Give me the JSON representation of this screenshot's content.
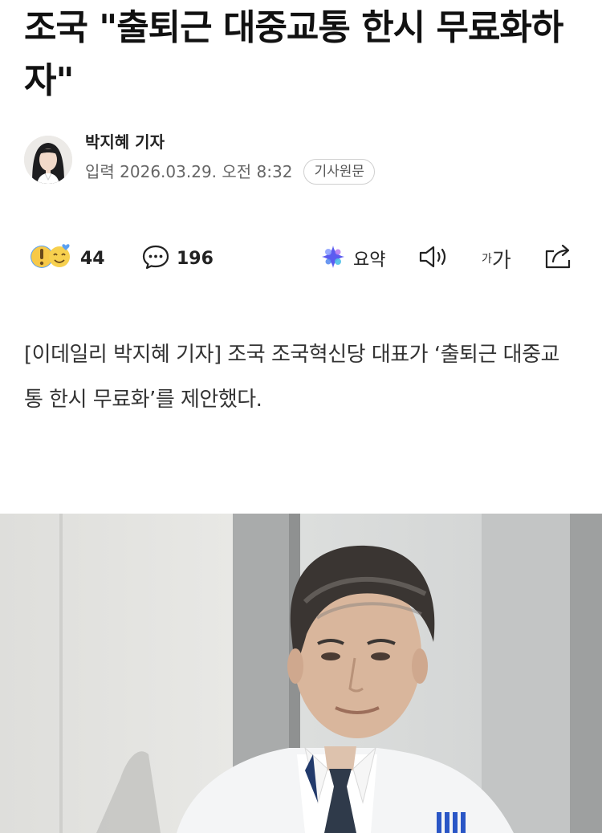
{
  "article": {
    "headline": "조국 \"출퇴근 대중교통 한시 무료화하자\"",
    "reporter": "박지혜 기자",
    "date": "입력 2026.03.29. 오전 8:32",
    "source_button": "기사원문",
    "lead": "[이데일리 박지혜 기자] 조국 조국혁신당 대표가 ‘출퇴근 대중교통 한시 무료화’를 제안했다."
  },
  "actions": {
    "reaction_count": "44",
    "comment_count": "196",
    "summary_label": "요약",
    "font_small_label": "가",
    "font_big_label": "가"
  },
  "icons": {
    "reaction": "emoji-reaction-icon",
    "comment": "comment-bubble-icon",
    "summary": "ai-summary-sparkle-icon",
    "audio": "speaker-icon",
    "share": "share-icon"
  },
  "colors": {
    "text": "#111111",
    "meta": "#666666",
    "summary_accent": "#5b5cf0",
    "reaction_yellow": "#f7c948",
    "reaction_blue": "#5aa0f2"
  }
}
